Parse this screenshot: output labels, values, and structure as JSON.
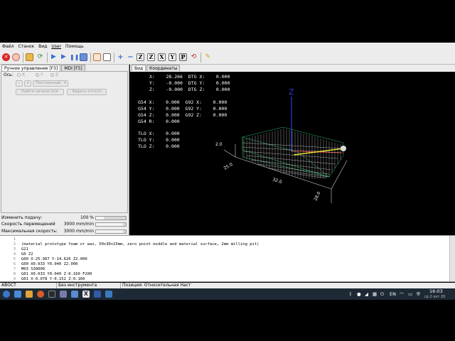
{
  "menubar": {
    "items": [
      "Файл",
      "Станок",
      "Вид",
      "User",
      "Помощь"
    ]
  },
  "toolbar": {
    "icons": [
      "estop-icon",
      "power-icon",
      "open-file-icon",
      "reload-icon",
      "run-icon",
      "step-icon",
      "pause-icon",
      "stop-icon",
      "block-delete-icon",
      "optional-stop-icon",
      "zoom-in-icon",
      "zoom-out-icon",
      "view-z-icon",
      "view-z2-icon",
      "view-x-icon",
      "view-y-icon",
      "view-p-icon",
      "rotate-icon",
      "clear-plot-icon"
    ],
    "labels": {
      "z": "Z",
      "z2": "Z",
      "x": "X",
      "y": "Y",
      "p": "P"
    }
  },
  "left_tabs": [
    "Ручное управление [F3]",
    "MDI [F5]"
  ],
  "manual": {
    "axis_label": "Ось:",
    "axes": [
      "X",
      "Y",
      "Z"
    ],
    "jog_minus": "-",
    "jog_plus": "+",
    "jog_mode": "Постоянный",
    "home_button": "Найти начало оси",
    "touch_off_button": "Задать отступ"
  },
  "overrides": [
    {
      "label": "Изменить подачу:",
      "value": "100 %",
      "level": 0.25
    },
    {
      "label": "Скорость перемещений",
      "value": "3000 mm/min",
      "level": 0.9
    },
    {
      "label": "Максимальная скорость:",
      "value": "3000 mm/min",
      "level": 0.9
    }
  ],
  "view_tabs": [
    "Вид",
    "Координаты"
  ],
  "dro": {
    "rows": [
      "X:    28.266  DTG X:    0.000",
      "Y:    -0.000  DTG Y:    0.000",
      "Z:    -0.000  DTG Z:    0.000",
      "",
      "G54 X:    0.000  G92 X:    0.000",
      "G54 Y:    0.000  G92 Y:    0.000",
      "G54 Z:    0.000  G92 Z:    0.000",
      "G54 R:    0.000",
      "",
      "TLO X:    0.000",
      "TLO Y:    0.000",
      "TLO Z:    0.000"
    ]
  },
  "preview": {
    "axis_label_z": "Z",
    "dim_labels": [
      "2.0",
      "25.0",
      "32.0",
      "28.0"
    ]
  },
  "gcode": {
    "lines": [
      {
        "n": "1",
        "text": ""
      },
      {
        "n": "2",
        "text": "(material prototype foam or wax, 50x30x15mm, zero point middle and material surface, 2mm milling pit)"
      },
      {
        "n": "3",
        "text": "G21"
      },
      {
        "n": "4",
        "text": "G0 Z2"
      },
      {
        "n": "5",
        "text": "G00 X-25.967 Y-14.626 Z2.000"
      },
      {
        "n": "6",
        "text": "G00 X0.033 Y0.040 Z2.000"
      },
      {
        "n": "7",
        "text": "M03 S30000"
      },
      {
        "n": "8",
        "text": "G01 X0.033 Y0.040 Z-0.160 F200"
      },
      {
        "n": "9",
        "text": "G01 X-0.078 Y-0.152 Z-0.160"
      }
    ]
  },
  "status": {
    "state": "АВОСТ",
    "tool": "Без инструмента",
    "position": "Позиция: Относительная Наст"
  },
  "taskbar": {
    "lang": "EN",
    "time": "16:03",
    "date": "ср 2 окт 20"
  }
}
